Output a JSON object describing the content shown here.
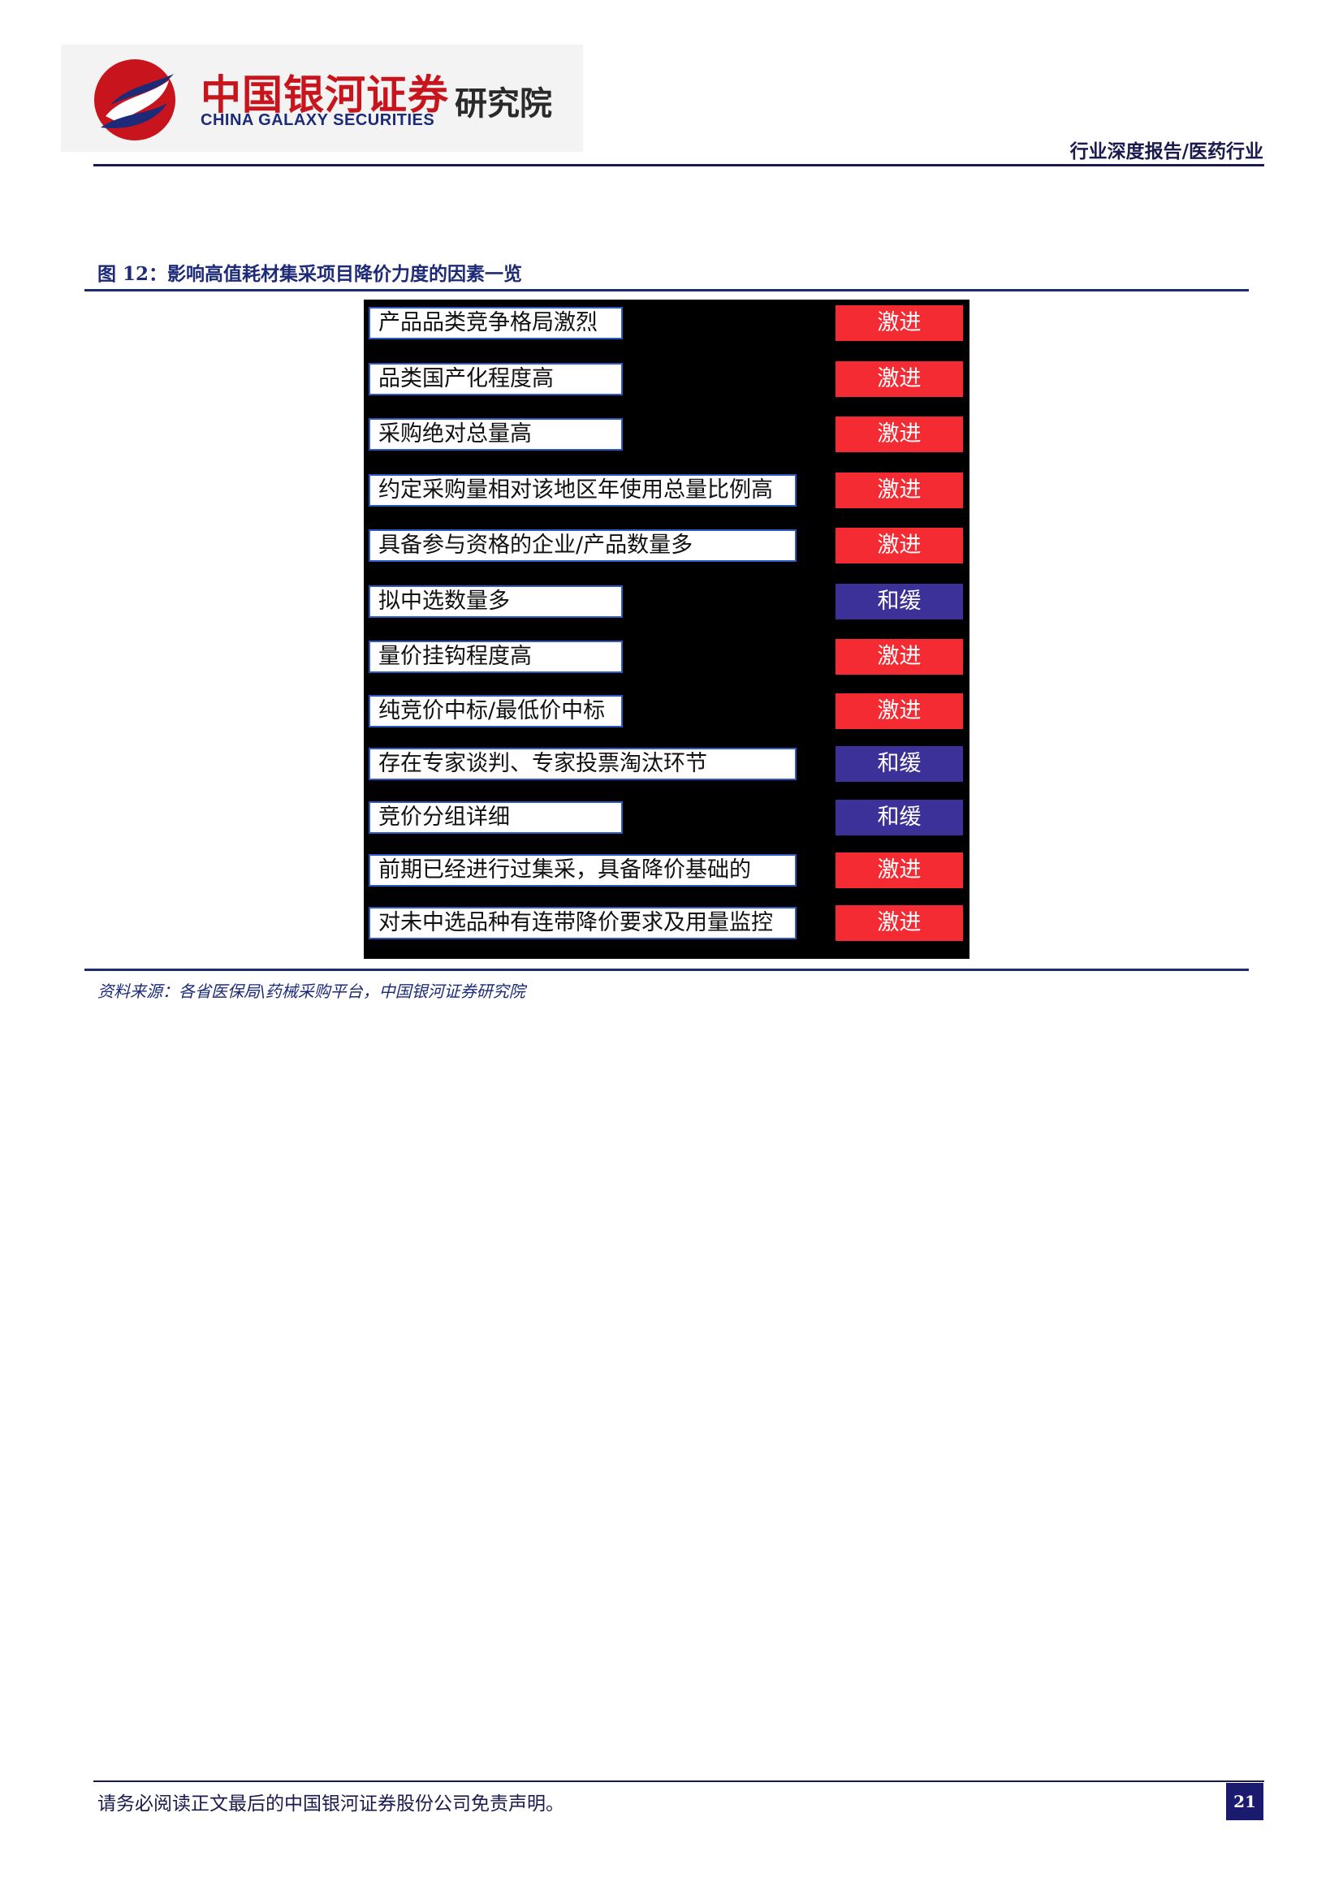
{
  "header": {
    "logo_cn": "中国银河证券",
    "logo_en": "CHINA GALAXY SECURITIES",
    "logo_institute": "研究院",
    "report_tag": "行业深度报告/医药行业"
  },
  "figure": {
    "title": "图 12：影响高值耗材集采项目降价力度的因素一览",
    "rows": [
      {
        "factor": "产品品类竞争格局激烈",
        "level": "激进",
        "color": "#f42b33"
      },
      {
        "factor": "品类国产化程度高",
        "level": "激进",
        "color": "#f42b33"
      },
      {
        "factor": "采购绝对总量高",
        "level": "激进",
        "color": "#f42b33"
      },
      {
        "factor": "约定采购量相对该地区年使用总量比例高",
        "level": "激进",
        "color": "#f42b33"
      },
      {
        "factor": "具备参与资格的企业/产品数量多",
        "level": "激进",
        "color": "#f42b33"
      },
      {
        "factor": "拟中选数量多",
        "level": "和缓",
        "color": "#3c3199"
      },
      {
        "factor": "量价挂钩程度高",
        "level": "激进",
        "color": "#f42b33"
      },
      {
        "factor": "纯竞价中标/最低价中标",
        "level": "激进",
        "color": "#f42b33"
      },
      {
        "factor": "存在专家谈判、专家投票淘汰环节",
        "level": "和缓",
        "color": "#3c3199"
      },
      {
        "factor": "竞价分组详细",
        "level": "和缓",
        "color": "#3c3199"
      },
      {
        "factor": "前期已经进行过集采，具备降价基础的",
        "level": "激进",
        "color": "#f42b33"
      },
      {
        "factor": "对未中选品种有连带降价要求及用量监控",
        "level": "激进",
        "color": "#f42b33"
      }
    ],
    "source": "资料来源：各省医保局\\药械采购平台，中国银河证券研究院"
  },
  "footer": {
    "disclaimer": "请务必阅读正文最后的中国银河证券股份公司免责声明。",
    "page_number": "21"
  }
}
